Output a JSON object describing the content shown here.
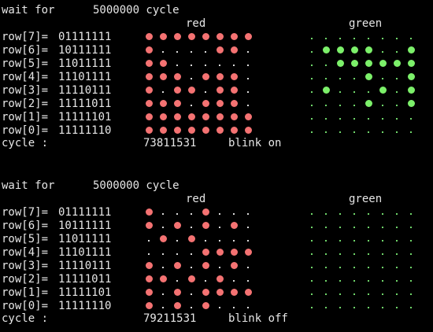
{
  "colors": {
    "background": "#000000",
    "text": "#e6e6e6",
    "red_led": "#f47272",
    "green_led": "#7cf06a"
  },
  "panels": [
    {
      "wait_label": "wait for",
      "wait_value": "5000000 cycle",
      "red_label": "red",
      "green_label": "green",
      "rows": [
        {
          "label": "row[7]=",
          "value": "01111111"
        },
        {
          "label": "row[6]=",
          "value": "10111111"
        },
        {
          "label": "row[5]=",
          "value": "11011111"
        },
        {
          "label": "row[4]=",
          "value": "11101111"
        },
        {
          "label": "row[3]=",
          "value": "11110111"
        },
        {
          "label": "row[2]=",
          "value": "11111011"
        },
        {
          "label": "row[1]=",
          "value": "11111101"
        },
        {
          "label": "row[0]=",
          "value": "11111110"
        }
      ],
      "red_matrix": [
        "11111111",
        "10000110",
        "11000000",
        "11101110",
        "10110110",
        "11101110",
        "11111111",
        "11111111"
      ],
      "green_matrix": [
        "00000000",
        "01111001",
        "00111111",
        "00001001",
        "01000101",
        "00001001",
        "00000000",
        "00000000"
      ],
      "cycle_label": "cycle :",
      "cycle_value": "73811531",
      "blink_text": "blink on"
    },
    {
      "wait_label": "wait for",
      "wait_value": "5000000 cycle",
      "red_label": "red",
      "green_label": "green",
      "rows": [
        {
          "label": "row[7]=",
          "value": "01111111"
        },
        {
          "label": "row[6]=",
          "value": "10111111"
        },
        {
          "label": "row[5]=",
          "value": "11011111"
        },
        {
          "label": "row[4]=",
          "value": "11101111"
        },
        {
          "label": "row[3]=",
          "value": "11110111"
        },
        {
          "label": "row[2]=",
          "value": "11111011"
        },
        {
          "label": "row[1]=",
          "value": "11111101"
        },
        {
          "label": "row[0]=",
          "value": "11111110"
        }
      ],
      "red_matrix": [
        "10001000",
        "10101010",
        "01010000",
        "00001111",
        "10101010",
        "11010100",
        "10101111",
        "10101000"
      ],
      "green_matrix": [
        "00000000",
        "00000000",
        "00000000",
        "00000000",
        "00000000",
        "00000000",
        "00000000",
        "00000000"
      ],
      "cycle_label": "cycle :",
      "cycle_value": "79211531",
      "blink_text": "blink off"
    }
  ]
}
